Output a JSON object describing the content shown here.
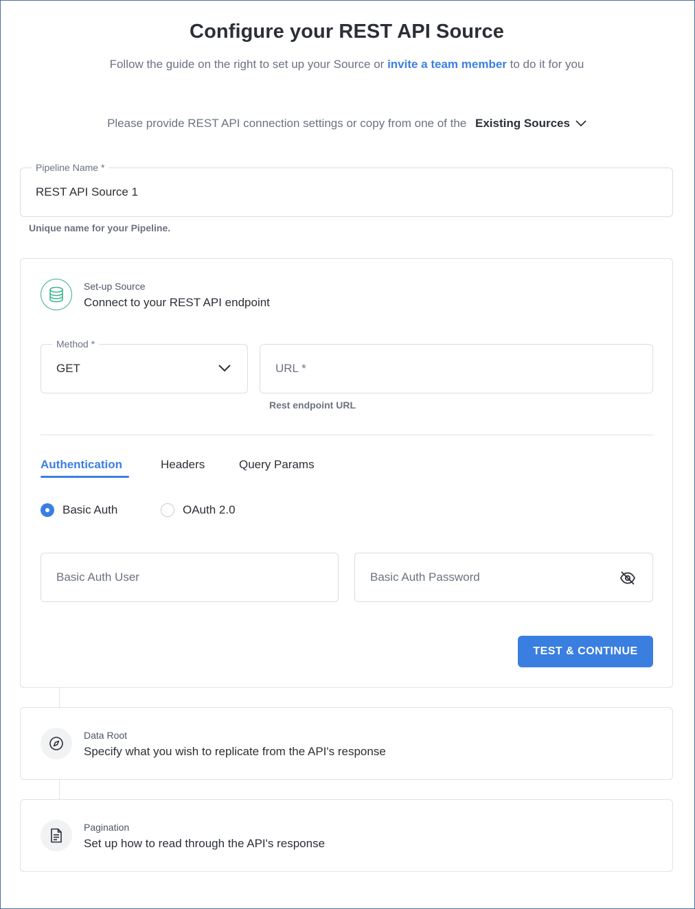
{
  "header": {
    "title": "Configure your REST API Source",
    "subtitle_prefix": "Follow the guide on the right to set up your Source or",
    "subtitle_link": "invite a team member",
    "subtitle_suffix": "to do it for you"
  },
  "existing": {
    "prompt": "Please provide REST API connection settings or copy from one of the",
    "dropdown_label": "Existing Sources"
  },
  "pipeline": {
    "label": "Pipeline Name *",
    "value": "REST API Source 1",
    "hint": "Unique name for your Pipeline."
  },
  "setup": {
    "small": "Set-up Source",
    "big": "Connect to your REST API endpoint",
    "method_label": "Method *",
    "method_value": "GET",
    "url_placeholder": "URL *",
    "url_hint": "Rest endpoint URL",
    "tabs": [
      "Authentication",
      "Headers",
      "Query Params"
    ],
    "active_tab": "Authentication",
    "auth_options": [
      "Basic Auth",
      "OAuth 2.0"
    ],
    "selected_auth": "Basic Auth",
    "user_placeholder": "Basic Auth User",
    "password_placeholder": "Basic Auth Password",
    "button": "TEST & CONTINUE"
  },
  "steps": [
    {
      "small": "Data Root",
      "big": "Specify what you wish to replicate from the API's response",
      "icon": "compass-icon"
    },
    {
      "small": "Pagination",
      "big": "Set up how to read through the API's response",
      "icon": "document-icon"
    }
  ],
  "colors": {
    "accent": "#3a7fe0",
    "success": "#3fb58c",
    "text": "#2b2f36",
    "muted": "#6b7280"
  }
}
